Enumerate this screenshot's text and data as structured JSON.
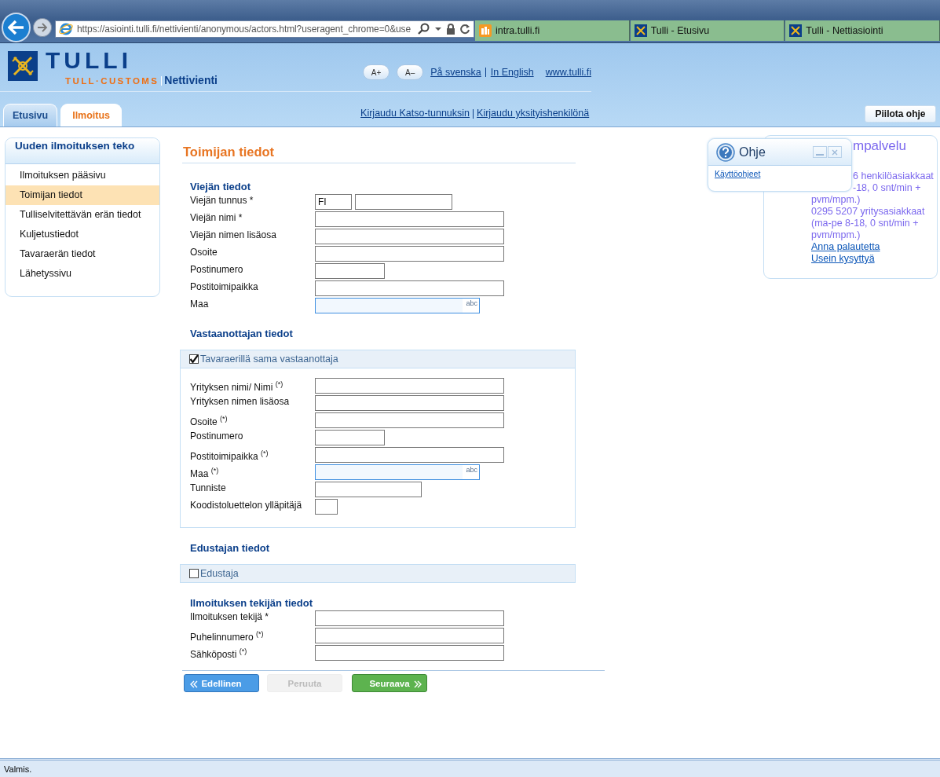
{
  "browser": {
    "address": "https://asiointi.tulli.fi/nettivienti/anonymous/actors.html?useragent_chrome=0&use",
    "tabs": [
      {
        "title": "intra.tulli.fi",
        "kind": "intranet"
      },
      {
        "title": "Tulli - Etusivu",
        "kind": "site"
      },
      {
        "title": "Tulli - Nettiasiointi",
        "kind": "site"
      }
    ]
  },
  "header": {
    "logo_title": "TULLI",
    "logo_subtitle": "TULL·CUSTOMS",
    "service": "Nettivienti",
    "font_buttons": [
      "A+",
      "A–"
    ],
    "language_links": [
      "På svenska",
      "In English"
    ],
    "site_link": "www.tulli.fi",
    "nav_tabs": [
      {
        "label": "Etusivu",
        "selected": false
      },
      {
        "label": "Ilmoitus",
        "selected": true
      }
    ],
    "login_links": [
      "Kirjaudu Katso-tunnuksin",
      "Kirjaudu yksityishenkilönä"
    ],
    "hide_help_button": "Piilota ohje"
  },
  "sidebar": {
    "title": "Uuden ilmoituksen teko",
    "items": [
      {
        "label": "Ilmoituksen pääsivu",
        "selected": false
      },
      {
        "label": "Toimijan tiedot",
        "selected": true
      },
      {
        "label": "Tulliselvitettävän erän tiedot",
        "selected": false
      },
      {
        "label": "Kuljetustiedot",
        "selected": false
      },
      {
        "label": "Tavaraerän tiedot",
        "selected": false
      },
      {
        "label": "Lähetyssivu",
        "selected": false
      }
    ]
  },
  "form": {
    "title": "Toimijan tiedot",
    "sections": [
      {
        "heading": "Viejän tiedot",
        "fields": [
          {
            "label": "Viejän tunnus *",
            "kind": "prefixed",
            "value": "FI"
          },
          {
            "label": "Viejän nimi *",
            "kind": "long"
          },
          {
            "label": "Viejän nimen lisäosa",
            "kind": "long"
          },
          {
            "label": "Osoite",
            "kind": "long"
          },
          {
            "label": "Postinumero",
            "kind": "short"
          },
          {
            "label": "Postitoimipaikka",
            "kind": "long"
          },
          {
            "label": "Maa",
            "kind": "lookup",
            "hint": "abc"
          }
        ]
      },
      {
        "heading": "Vastaanottajan tiedot",
        "checkbox": {
          "label": "Tavaraerillä sama vastaanottaja",
          "checked": true
        },
        "fields": [
          {
            "label": "Yrityksen nimi/ Nimi $^{(*)}$",
            "kind": "long"
          },
          {
            "label": "Yrityksen nimen lisäosa",
            "kind": "long"
          },
          {
            "label": "Osoite $^{(*)}$",
            "kind": "long"
          },
          {
            "label": "Postinumero",
            "kind": "short"
          },
          {
            "label": "Postitoimipaikka $^{(*)}$",
            "kind": "long"
          },
          {
            "label": "Maa $^{(*)}$",
            "kind": "lookup",
            "hint": "abc"
          },
          {
            "label": "Tunniste",
            "kind": "medium"
          },
          {
            "label": "Koodistoluettelon ylläpitäjä",
            "kind": "tiny"
          }
        ]
      },
      {
        "heading": "Edustajan tiedot",
        "checkbox": {
          "label": "Edustaja",
          "checked": false
        }
      },
      {
        "heading": "Ilmoituksen tekijän tiedot",
        "fields": [
          {
            "label": "Ilmoituksen tekijä *",
            "kind": "long"
          },
          {
            "label": "Puhelinnumero $^{(*)}$",
            "kind": "long"
          },
          {
            "label": "Sähköposti $^{(*)}$",
            "kind": "long"
          }
        ]
      }
    ],
    "buttons": [
      {
        "label": "Edellinen",
        "kind": "back",
        "disabled": false
      },
      {
        "label": "Peruuta",
        "kind": "cancel",
        "disabled": true
      },
      {
        "label": "Seuraava",
        "kind": "next",
        "disabled": false
      }
    ]
  },
  "service_panel": {
    "title": "mpalvelu",
    "lines": [
      {
        "text": "6 henkilöasiakkaat",
        "kind": "partial"
      },
      {
        "text": "-18, 0 snt/min +",
        "kind": "partial"
      },
      {
        "text": "pvm/mpm.)",
        "kind": "text"
      },
      {
        "text": "0295 5207 yritysasiakkaat",
        "kind": "text"
      },
      {
        "text": "(ma-pe 8-18, 0 snt/min +",
        "kind": "text"
      },
      {
        "text": "pvm/mpm.)",
        "kind": "text"
      },
      {
        "text": "Anna palautetta",
        "kind": "link"
      },
      {
        "text": "Usein kysyttyä",
        "kind": "link"
      }
    ]
  },
  "help_popup": {
    "title": "Ohje",
    "link": "Käyttöohjeet"
  },
  "status_bar": "Valmis."
}
